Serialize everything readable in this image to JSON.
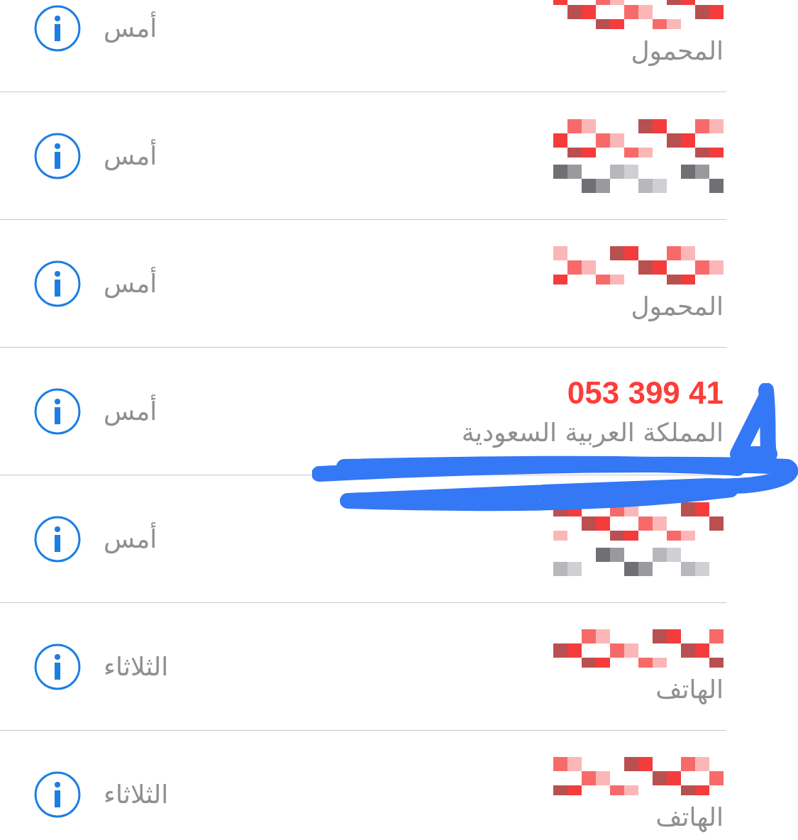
{
  "calls": [
    {
      "label": "المحمول",
      "time": "أمس",
      "missed": true
    },
    {
      "time": "أمس",
      "missed": true
    },
    {
      "label": "المحمول",
      "time": "أمس",
      "missed": true
    },
    {
      "name": "053 399 41",
      "label": "المملكة العربية السعودية",
      "time": "أمس",
      "missed": true
    },
    {
      "time": "أمس",
      "missed": true
    },
    {
      "label": "الهاتف",
      "time": "الثلاثاء",
      "missed": true
    },
    {
      "label": "الهاتف",
      "time": "الثلاثاء",
      "missed": true
    }
  ]
}
